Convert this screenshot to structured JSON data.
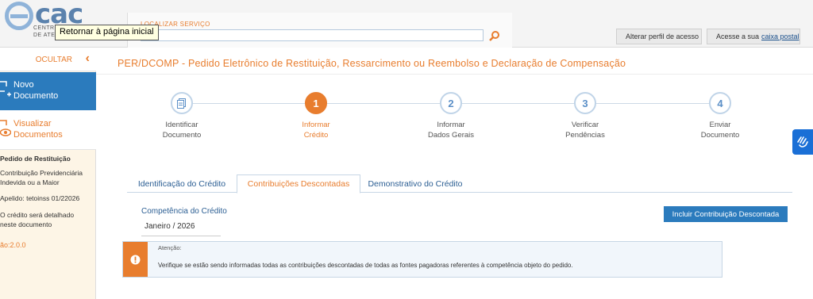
{
  "header": {
    "logo_text": "cac",
    "logo_sub_line1": "CENTRO",
    "logo_sub_line2": "DE ATEN",
    "tooltip": "Retornar à página inicial",
    "search_label": "LOCALIZAR SERVIÇO",
    "search_value": "",
    "profile_button": "Alterar perfil de acesso",
    "mailbox_prefix": "Acesse a sua",
    "mailbox_link": "caixa postal"
  },
  "sidebar": {
    "hide_label": "OCULTAR",
    "new_doc_line1": "Novo",
    "new_doc_line2": "Documento",
    "view_docs_line1": "Visualizar",
    "view_docs_line2": "Documentos",
    "info_type": "Pedido de Restituição",
    "info_desc_line1": "Contribuição Previdenciária",
    "info_desc_line2": "Indevida ou a Maior",
    "info_alias": "Apelido: tetoinss 01/22026",
    "info_detail_line1": "O crédito será detalhado",
    "info_detail_line2": "neste documento",
    "version": "ão:2.0.0"
  },
  "main": {
    "title": "PER/DCOMP - Pedido Eletrônico de Restituição, Ressarcimento ou Reembolso e Declaração de Compensação",
    "steps": [
      {
        "number": "",
        "line1": "Identificar",
        "line2": "Documento"
      },
      {
        "number": "1",
        "line1": "Informar",
        "line2": "Crédito"
      },
      {
        "number": "2",
        "line1": "Informar",
        "line2": "Dados Gerais"
      },
      {
        "number": "3",
        "line1": "Verificar",
        "line2": "Pendências"
      },
      {
        "number": "4",
        "line1": "Enviar",
        "line2": "Documento"
      }
    ],
    "active_step": 1,
    "tabs": [
      {
        "label": "Identificação do Crédito"
      },
      {
        "label": "Contribuições Descontadas"
      },
      {
        "label": "Demonstrativo do Crédito"
      }
    ],
    "active_tab": 1,
    "competencia_label": "Competência do Crédito",
    "competencia_value": "Janeiro / 2026",
    "add_button": "Incluir Contribuição Descontada",
    "alert_title": "Atenção:",
    "alert_text": "Verifique se estão sendo informadas todas as contribuições descontadas de todas as fontes pagadoras referentes à competência objeto do pedido."
  },
  "colors": {
    "accent_orange": "#e87d2e",
    "primary_blue": "#2b7bbd",
    "link_blue": "#2b5e93",
    "accessibility_blue": "#1a6fd6"
  }
}
